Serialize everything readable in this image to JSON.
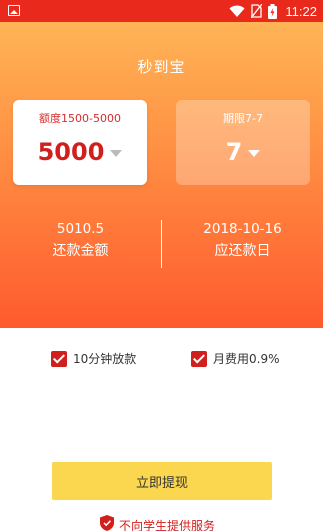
{
  "status_bar": {
    "time": "11:22",
    "icons": [
      "image-icon",
      "wifi-icon",
      "no-sim-icon",
      "battery-charging-icon"
    ]
  },
  "header": {
    "title": "秒到宝"
  },
  "amount_card": {
    "label": "额度1500-5000",
    "value": "5000"
  },
  "term_card": {
    "label": "期限7-7",
    "value": "7"
  },
  "stats": {
    "repay_amount": {
      "value": "5010.5",
      "label": "还款金额"
    },
    "repay_date": {
      "value": "2018-10-16",
      "label": "应还款日"
    }
  },
  "options": [
    {
      "label": "10分钟放款",
      "checked": true
    },
    {
      "label": "月费用0.9%",
      "checked": true
    }
  ],
  "submit": {
    "label": "立即提现"
  },
  "footer": {
    "notice": "不向学生提供服务"
  },
  "colors": {
    "status_bar": "#e8291c",
    "accent_red": "#d0201d",
    "button_yellow": "#fbd64f",
    "gradient_top": "#ffb456",
    "gradient_bottom": "#ff5a2e"
  }
}
